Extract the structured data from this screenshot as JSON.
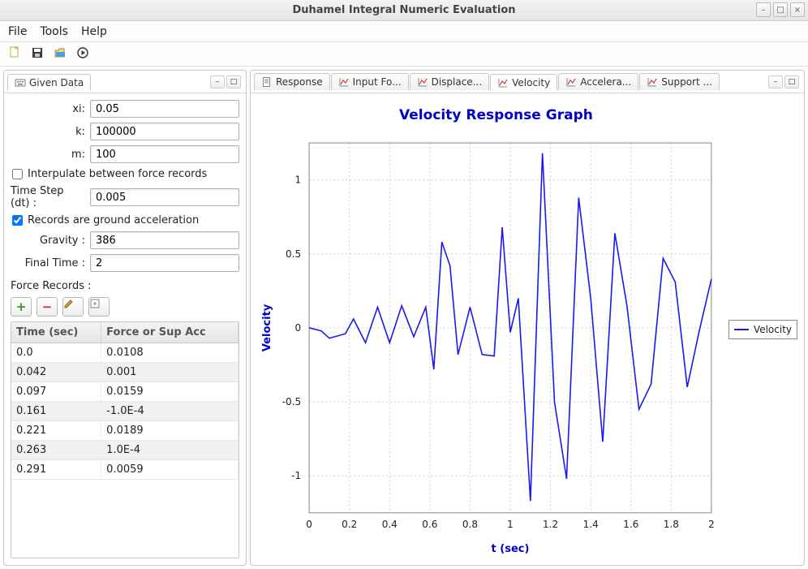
{
  "window": {
    "title": "Duhamel Integral Numeric Evaluation"
  },
  "menubar": [
    "File",
    "Tools",
    "Help"
  ],
  "left_panel": {
    "tab": "Given Data",
    "fields": {
      "xi_label": "xi:",
      "xi_value": "0.05",
      "k_label": "k:",
      "k_value": "100000",
      "m_label": "m:",
      "m_value": "100",
      "interp_label": "Interpulate between force records",
      "dt_label": "Time Step (dt) :",
      "dt_value": "0.005",
      "ground_label": "Records are ground acceleration",
      "gravity_label": "Gravity :",
      "gravity_value": "386",
      "final_time_label": "Final Time :",
      "final_time_value": "2"
    },
    "force_records_label": "Force Records :",
    "table": {
      "col_time": "Time (sec)",
      "col_force": "Force or Sup Acc",
      "rows": [
        {
          "t": "0.0",
          "f": "0.0108"
        },
        {
          "t": "0.042",
          "f": "0.001"
        },
        {
          "t": "0.097",
          "f": "0.0159"
        },
        {
          "t": "0.161",
          "f": "-1.0E-4"
        },
        {
          "t": "0.221",
          "f": "0.0189"
        },
        {
          "t": "0.263",
          "f": "1.0E-4"
        },
        {
          "t": "0.291",
          "f": "0.0059"
        }
      ]
    }
  },
  "right_panel": {
    "tabs": [
      "Response",
      "Input Fo...",
      "Displace...",
      "Velocity",
      "Accelera...",
      "Support ..."
    ],
    "selected_tab": 3
  },
  "chart": {
    "title": "Velocity Response Graph",
    "xlabel": "t (sec)",
    "ylabel": "Velocity",
    "legend": "Velocity"
  },
  "chart_data": {
    "type": "line",
    "title": "Velocity Response Graph",
    "xlabel": "t (sec)",
    "ylabel": "Velocity",
    "xlim": [
      0,
      2
    ],
    "ylim": [
      -1.25,
      1.25
    ],
    "xticks": [
      0,
      0.2,
      0.4,
      0.6,
      0.8,
      1,
      1.2,
      1.4,
      1.6,
      1.8,
      2
    ],
    "yticks": [
      -1,
      -0.5,
      0,
      0.5,
      1
    ],
    "series": [
      {
        "name": "Velocity",
        "x": [
          0.0,
          0.06,
          0.1,
          0.18,
          0.22,
          0.28,
          0.34,
          0.4,
          0.46,
          0.52,
          0.58,
          0.62,
          0.66,
          0.7,
          0.74,
          0.8,
          0.86,
          0.92,
          0.96,
          1.0,
          1.04,
          1.1,
          1.16,
          1.22,
          1.28,
          1.34,
          1.4,
          1.46,
          1.52,
          1.58,
          1.64,
          1.7,
          1.76,
          1.82,
          1.88,
          1.94,
          2.0
        ],
        "y": [
          0.0,
          -0.02,
          -0.07,
          -0.04,
          0.06,
          -0.1,
          0.14,
          -0.1,
          0.15,
          -0.06,
          0.14,
          -0.28,
          0.58,
          0.42,
          -0.18,
          0.14,
          -0.18,
          -0.19,
          0.68,
          -0.03,
          0.2,
          -1.17,
          1.18,
          -0.5,
          -1.02,
          0.88,
          0.2,
          -0.77,
          0.64,
          0.15,
          -0.55,
          -0.38,
          0.47,
          0.31,
          -0.4,
          -0.02,
          0.33
        ]
      }
    ]
  }
}
